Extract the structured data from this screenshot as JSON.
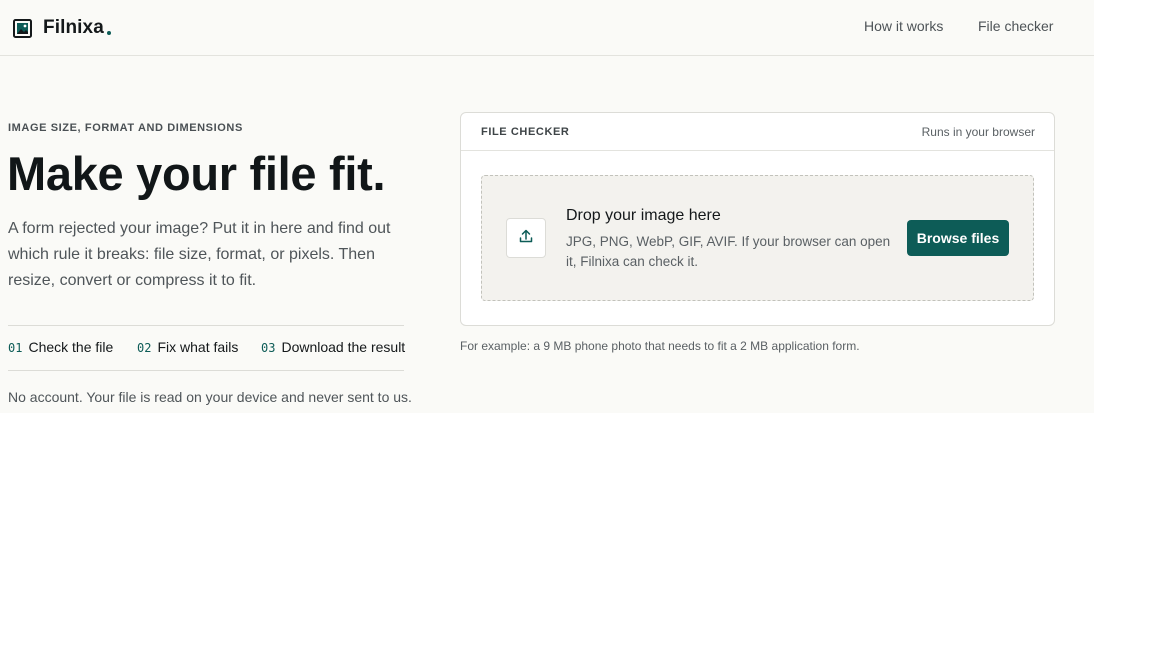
{
  "header": {
    "brand_name": "Filnixa",
    "brand_icon": "image-frame-icon",
    "nav": {
      "how_it_works": "How it works",
      "file_checker": "File checker"
    }
  },
  "hero": {
    "eyebrow": "IMAGE SIZE, FORMAT AND DIMENSIONS",
    "title": "Make your file fit.",
    "description": "A form rejected your image? Put it in here and find out which rule it breaks: file size, format, or pixels. Then resize, convert or compress it to fit.",
    "steps": [
      {
        "num": "01",
        "label": "Check the file"
      },
      {
        "num": "02",
        "label": "Fix what fails"
      },
      {
        "num": "03",
        "label": "Download the result"
      }
    ],
    "privacy_note": "No account. Your file is read on your device and never sent to us."
  },
  "checker": {
    "title": "FILE CHECKER",
    "note": "Runs in your browser",
    "dropzone": {
      "icon": "upload-icon",
      "title": "Drop your image here",
      "description": "JPG, PNG, WebP, GIF, AVIF. If your browser can open it, Filnixa can check it.",
      "button_label": "Browse files"
    },
    "example": "For example: a 9 MB phone photo that needs to fit a 2 MB application form."
  },
  "colors": {
    "accent": "#0d5c57",
    "page_background": "#fafaf7",
    "dropzone_background": "#f3f2ee",
    "text_primary": "#14181a",
    "text_muted": "#5a6064"
  }
}
